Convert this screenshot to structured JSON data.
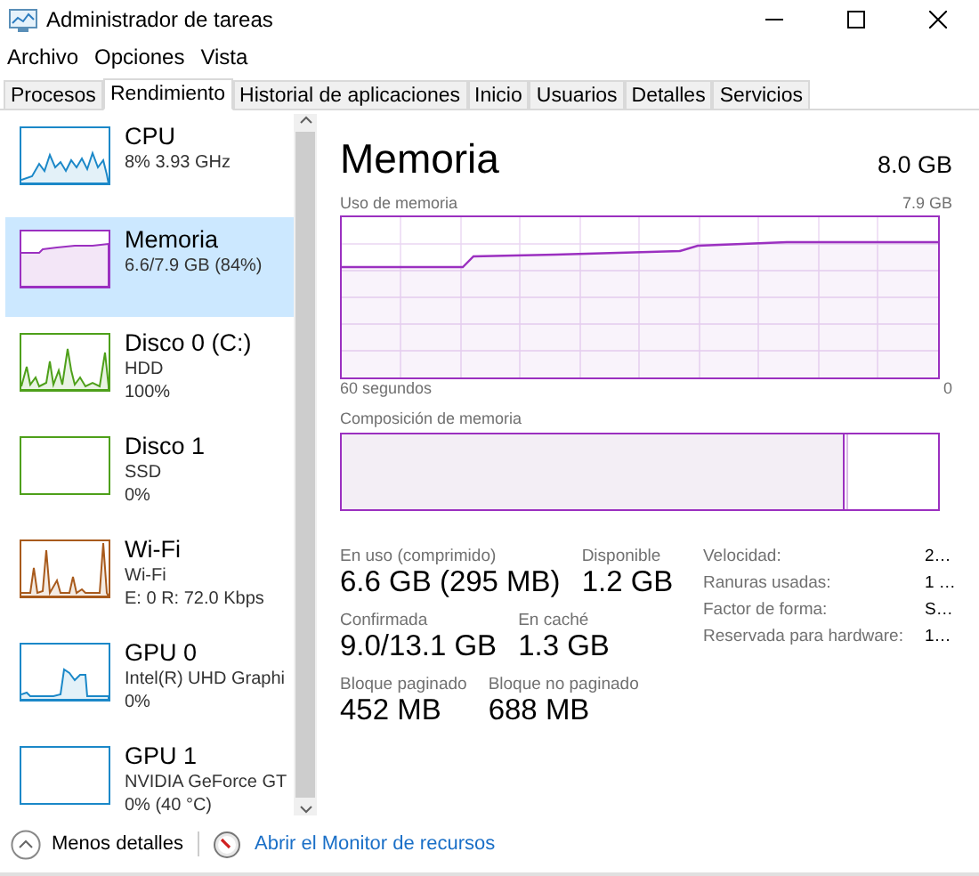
{
  "window": {
    "title": "Administrador de tareas"
  },
  "menu": [
    "Archivo",
    "Opciones",
    "Vista"
  ],
  "tabs": [
    {
      "label": "Procesos",
      "selected": false
    },
    {
      "label": "Rendimiento",
      "selected": true
    },
    {
      "label": "Historial de aplicaciones",
      "selected": false
    },
    {
      "label": "Inicio",
      "selected": false
    },
    {
      "label": "Usuarios",
      "selected": false
    },
    {
      "label": "Detalles",
      "selected": false
    },
    {
      "label": "Servicios",
      "selected": false
    }
  ],
  "sidebar": {
    "items": [
      {
        "kind": "cpu",
        "color": "#1b88c8",
        "name": "CPU",
        "lines": [
          "8%  3.93 GHz"
        ],
        "selected": false
      },
      {
        "kind": "memory",
        "color": "#9b30c0",
        "name": "Memoria",
        "lines": [
          "6.6/7.9 GB (84%)"
        ],
        "selected": true
      },
      {
        "kind": "disk",
        "color": "#4ea01a",
        "name": "Disco 0 (C:)",
        "lines": [
          "HDD",
          "100%"
        ],
        "selected": false
      },
      {
        "kind": "idle",
        "color": "#4ea01a",
        "name": "Disco 1",
        "lines": [
          "SSD",
          "0%"
        ],
        "selected": false
      },
      {
        "kind": "wifi",
        "color": "#a85a1c",
        "name": "Wi-Fi",
        "lines": [
          "Wi-Fi",
          "E: 0 R: 72.0 Kbps"
        ],
        "selected": false
      },
      {
        "kind": "gpu",
        "color": "#1b88c8",
        "name": "GPU 0",
        "lines": [
          "Intel(R) UHD Graphi",
          "0%"
        ],
        "selected": false
      },
      {
        "kind": "idle",
        "color": "#1b88c8",
        "name": "GPU 1",
        "lines": [
          "NVIDIA GeForce GT",
          "0% (40 °C)"
        ],
        "selected": false
      }
    ]
  },
  "detail": {
    "title": "Memoria",
    "total": "8.0 GB",
    "usage_chart": {
      "label": "Uso de memoria",
      "max": "7.9 GB",
      "time_span": "60 segundos",
      "min": "0"
    },
    "composition_label": "Composición de memoria",
    "stats": [
      {
        "label": "En uso (comprimido)",
        "value": "6.6 GB (295 MB)"
      },
      {
        "label": "Disponible",
        "value": "1.2 GB"
      },
      {
        "label": "Confirmada",
        "value": "9.0/13.1 GB"
      },
      {
        "label": "En caché",
        "value": "1.3 GB"
      },
      {
        "label": "Bloque paginado",
        "value": "452 MB"
      },
      {
        "label": "Bloque no paginado",
        "value": "688 MB"
      }
    ],
    "properties": [
      {
        "label": "Velocidad:",
        "value": "2…"
      },
      {
        "label": "Ranuras usadas:",
        "value": "1 …"
      },
      {
        "label": "Factor de forma:",
        "value": "S…"
      },
      {
        "label": "Reservada para hardware:",
        "value": "1…"
      }
    ]
  },
  "footer": {
    "less_details": "Menos detalles",
    "resource_monitor": "Abrir el Monitor de recursos"
  }
}
